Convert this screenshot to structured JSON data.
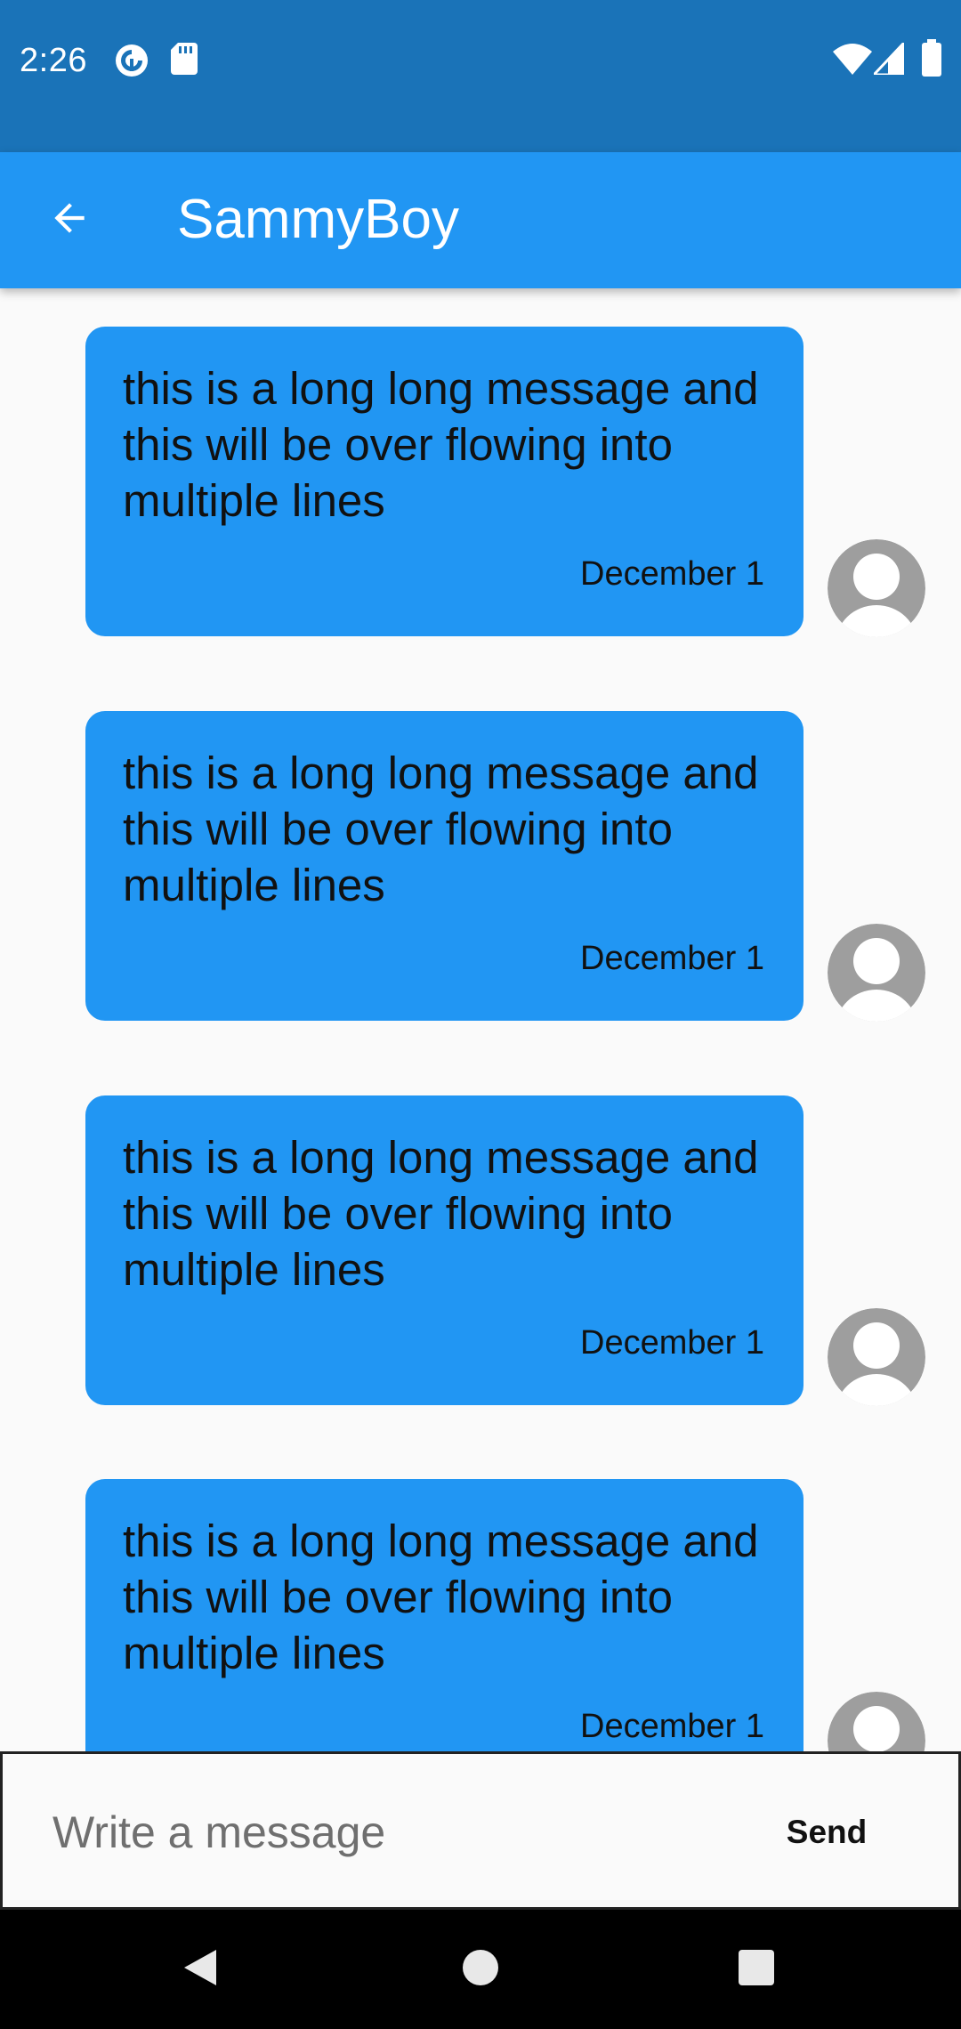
{
  "status_bar": {
    "time": "2:26",
    "icons_left": [
      "pocket-casts-icon",
      "sd-card-icon"
    ],
    "icons_right": [
      "wifi-icon",
      "cellular-signal-icon",
      "battery-icon"
    ]
  },
  "app_bar": {
    "back_icon": "arrow-back-icon",
    "title": "SammyBoy"
  },
  "messages": [
    {
      "text": "this is a long long message and this will be over flowing into multiple lines",
      "date": "December 1",
      "avatar": "person-avatar-icon"
    },
    {
      "text": "this is a long long message and this will be over flowing into multiple lines",
      "date": "December 1",
      "avatar": "person-avatar-icon"
    },
    {
      "text": "this is a long long message and this will be over flowing into multiple lines",
      "date": "December 1",
      "avatar": "person-avatar-icon"
    },
    {
      "text": "this is a long long message and this will be over flowing into multiple lines",
      "date": "December 1",
      "avatar": "person-avatar-icon"
    }
  ],
  "composer": {
    "placeholder": "Write a message",
    "value": "",
    "send_label": "Send"
  },
  "nav_bar": {
    "buttons": [
      "back-triangle-icon",
      "home-circle-icon",
      "recents-square-icon"
    ]
  },
  "colors": {
    "status_bar": "#1a73b8",
    "app_bar": "#2196f3",
    "bubble": "#2196f3",
    "background": "#fafafa",
    "avatar": "#9e9e9e",
    "nav_bar": "#000000"
  }
}
